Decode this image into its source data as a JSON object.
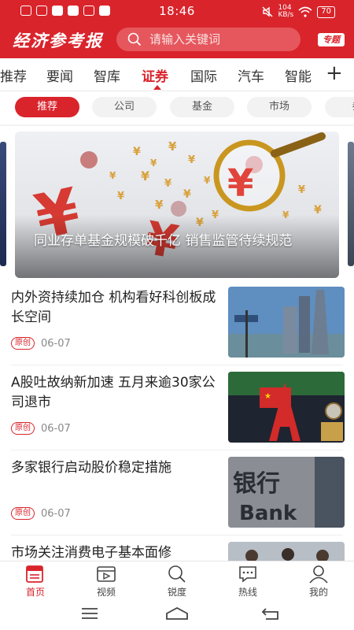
{
  "status_bar": {
    "time": "18:46",
    "network_speed": "104\nKB/s",
    "battery": "70"
  },
  "header": {
    "logo": "经济参考报",
    "search_placeholder": "请输入关键词",
    "special_label": "专题"
  },
  "main_tabs": [
    {
      "label": "推荐",
      "active": false
    },
    {
      "label": "要闻",
      "active": false
    },
    {
      "label": "智库",
      "active": false
    },
    {
      "label": "证券",
      "active": true
    },
    {
      "label": "国际",
      "active": false
    },
    {
      "label": "汽车",
      "active": false
    },
    {
      "label": "智能",
      "active": false
    }
  ],
  "sub_tabs": [
    {
      "label": "推荐",
      "active": true
    },
    {
      "label": "公司",
      "active": false
    },
    {
      "label": "基金",
      "active": false
    },
    {
      "label": "市场",
      "active": false
    },
    {
      "label": "券",
      "active": false
    }
  ],
  "banner": {
    "caption": "同业存单基金规模破千亿 销售监管待续规范"
  },
  "news": [
    {
      "title": "内外资持续加仓 机构看好科创板成长空间",
      "badge": "原创",
      "date": "06-07",
      "thumb": "skyscrapers"
    },
    {
      "title": "A股吐故纳新加速 五月来逾30家公司退市",
      "badge": "原创",
      "date": "06-07",
      "thumb": "a-share"
    },
    {
      "title": "多家银行启动股价稳定措施",
      "badge": "原创",
      "date": "06-07",
      "thumb": "bank"
    },
    {
      "title": "市场关注消费电子基本面修",
      "badge": "",
      "date": "",
      "thumb": "people"
    }
  ],
  "bottom_nav": [
    {
      "label": "首页",
      "icon": "news-icon",
      "active": true
    },
    {
      "label": "视频",
      "icon": "video-icon",
      "active": false
    },
    {
      "label": "锐度",
      "icon": "search-icon",
      "active": false
    },
    {
      "label": "热线",
      "icon": "chat-icon",
      "active": false
    },
    {
      "label": "我的",
      "icon": "user-icon",
      "active": false
    }
  ],
  "colors": {
    "brand_red": "#d9242c",
    "text": "#222222",
    "muted": "#888888"
  }
}
